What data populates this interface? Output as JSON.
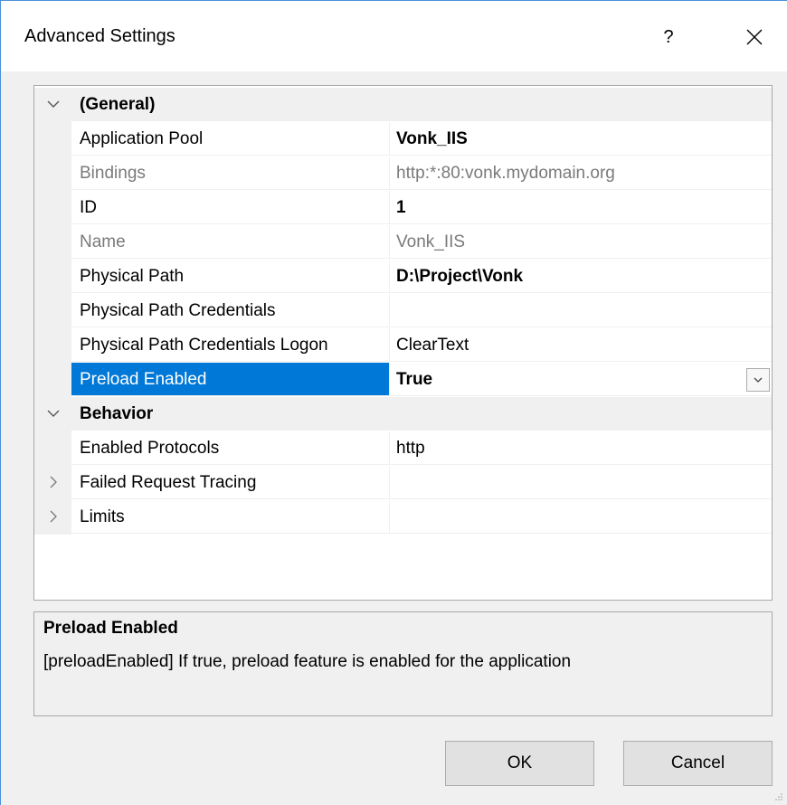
{
  "dialog": {
    "title": "Advanced Settings",
    "help_label": "?",
    "close_icon": "close-icon"
  },
  "grid": {
    "rows": [
      {
        "kind": "category",
        "expanded": true,
        "name": "(General)"
      },
      {
        "kind": "property",
        "name": "Application Pool",
        "value": "Vonk_IIS",
        "value_bold": true
      },
      {
        "kind": "property",
        "name": "Bindings",
        "value": "http:*:80:vonk.mydomain.org",
        "disabled": true
      },
      {
        "kind": "property",
        "name": "ID",
        "value": "1",
        "value_bold": true
      },
      {
        "kind": "property",
        "name": "Name",
        "value": "Vonk_IIS",
        "disabled": true
      },
      {
        "kind": "property",
        "name": "Physical Path",
        "value": "D:\\Project\\Vonk",
        "value_bold": true
      },
      {
        "kind": "property",
        "name": "Physical Path Credentials",
        "value": ""
      },
      {
        "kind": "property",
        "name": "Physical Path Credentials Logon",
        "value": "ClearText"
      },
      {
        "kind": "property",
        "name": "Preload Enabled",
        "value": "True",
        "value_bold": true,
        "selected": true
      },
      {
        "kind": "category",
        "expanded": true,
        "name": "Behavior"
      },
      {
        "kind": "property",
        "name": "Enabled Protocols",
        "value": "http"
      },
      {
        "kind": "property",
        "name": "Failed Request Tracing",
        "value": "",
        "expandable": true
      },
      {
        "kind": "property",
        "name": "Limits",
        "value": "",
        "expandable": true
      }
    ]
  },
  "description": {
    "title": "Preload Enabled",
    "text": "[preloadEnabled] If true, preload feature is enabled for the application"
  },
  "buttons": {
    "ok": "OK",
    "cancel": "Cancel"
  },
  "colors": {
    "selection": "#0078d7",
    "category_bg": "#f0f0f0",
    "disabled_text": "#7a7a7a"
  }
}
